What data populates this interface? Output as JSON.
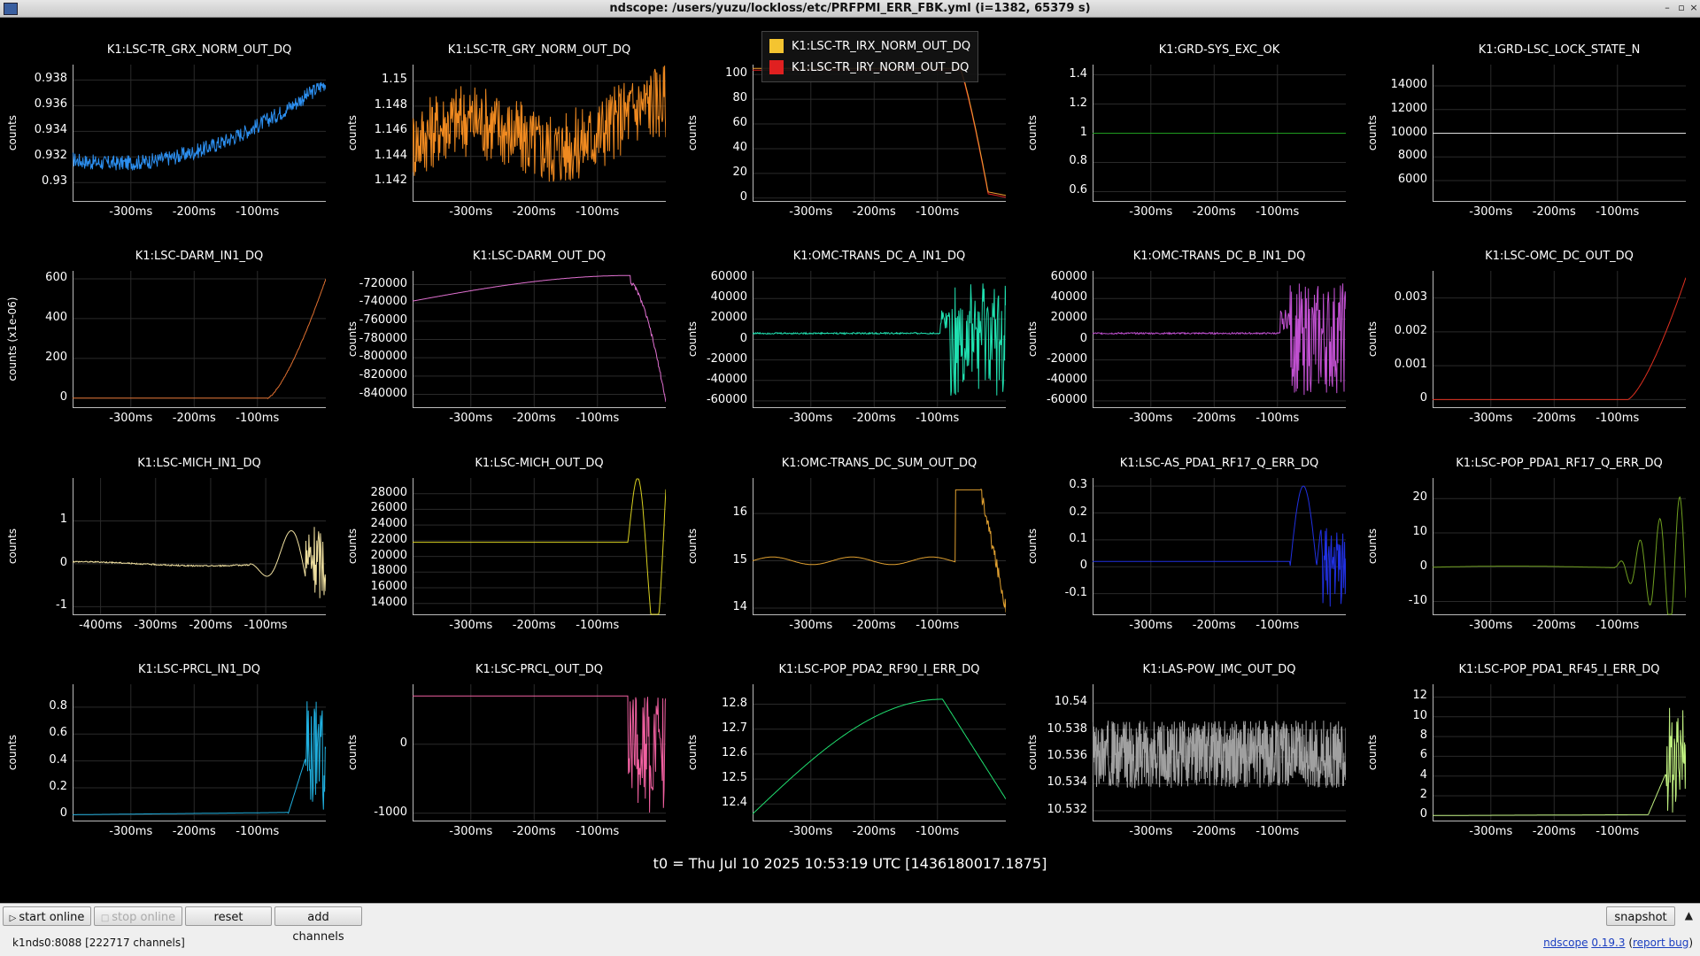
{
  "window": {
    "title": "ndscope: /users/yuzu/lockloss/etc/PRFPMI_ERR_FBK.yml (i=1382, 65379 s)"
  },
  "t0_label": "t0 = Thu Jul 10 2025 10:53:19 UTC [1436180017.1875]",
  "toolbar": {
    "start_online": "start online",
    "stop_online": "stop online",
    "reset": "reset",
    "add_channels": "add channels",
    "snapshot": "snapshot"
  },
  "status": {
    "server": "k1nds0:8088  [222717 channels]",
    "app_link": "ndscope",
    "version": "0.19.3",
    "open_paren": "(",
    "report_bug": "report bug",
    "close_paren": ")"
  },
  "panels": [
    {
      "title": "K1:LSC-TR_GRX_NORM_OUT_DQ",
      "ylabel": "counts",
      "color": "#2c8ff0",
      "yticks": [
        "0.938",
        "0.936",
        "0.934",
        "0.932",
        "0.93"
      ],
      "ytick_values": [
        0.938,
        0.936,
        0.934,
        0.932,
        0.93
      ],
      "ylim": [
        0.9285,
        0.9392
      ],
      "xticks": [
        "-300ms",
        "-200ms",
        "-100ms"
      ]
    },
    {
      "title": "K1:LSC-TR_GRY_NORM_OUT_DQ",
      "ylabel": "counts",
      "color": "#f08a20",
      "yticks": [
        "1.15",
        "1.148",
        "1.146",
        "1.144",
        "1.142"
      ],
      "ytick_values": [
        1.15,
        1.148,
        1.146,
        1.144,
        1.142
      ],
      "ylim": [
        1.1404,
        1.1513
      ],
      "xticks": [
        "-300ms",
        "-200ms",
        "-100ms"
      ]
    },
    {
      "title": "",
      "ylabel": "counts",
      "color": "#f0a030",
      "yticks": [
        "100",
        "80",
        "60",
        "40",
        "20",
        "0"
      ],
      "ytick_values": [
        100,
        80,
        60,
        40,
        20,
        0
      ],
      "ylim": [
        -3,
        108
      ],
      "xticks": [
        "-300ms",
        "-200ms",
        "-100ms"
      ],
      "legend": [
        {
          "name": "K1:LSC-TR_IRX_NORM_OUT_DQ",
          "color": "#f4c430"
        },
        {
          "name": "K1:LSC-TR_IRY_NORM_OUT_DQ",
          "color": "#e02020"
        }
      ]
    },
    {
      "title": "K1:GRD-SYS_EXC_OK",
      "ylabel": "counts",
      "color": "#1f9a1f",
      "yticks": [
        "1.4",
        "1.2",
        "1",
        "0.8",
        "0.6"
      ],
      "ytick_values": [
        1.4,
        1.2,
        1,
        0.8,
        0.6
      ],
      "ylim": [
        0.53,
        1.47
      ],
      "xticks": [
        "-300ms",
        "-200ms",
        "-100ms"
      ]
    },
    {
      "title": "K1:GRD-LSC_LOCK_STATE_N",
      "ylabel": "counts",
      "color": "#e0e0e0",
      "yticks": [
        "14000",
        "12000",
        "10000",
        "8000",
        "6000"
      ],
      "ytick_values": [
        14000,
        12000,
        10000,
        8000,
        6000
      ],
      "ylim": [
        4200,
        15800
      ],
      "xticks": [
        "-300ms",
        "-200ms",
        "-100ms"
      ]
    },
    {
      "title": "K1:LSC-DARM_IN1_DQ",
      "ylabel": "counts (x1e-06)",
      "color": "#e07030",
      "yticks": [
        "600",
        "400",
        "200",
        "0"
      ],
      "ytick_values": [
        600,
        400,
        200,
        0
      ],
      "ylim": [
        -50,
        640
      ],
      "xticks": [
        "-300ms",
        "-200ms",
        "-100ms"
      ]
    },
    {
      "title": "K1:LSC-DARM_OUT_DQ",
      "ylabel": "counts",
      "color": "#e070d0",
      "yticks": [
        "-720000",
        "-740000",
        "-760000",
        "-780000",
        "-800000",
        "-820000",
        "-840000"
      ],
      "ytick_values": [
        -720000,
        -740000,
        -760000,
        -780000,
        -800000,
        -820000,
        -840000
      ],
      "ylim": [
        -855000,
        -705000
      ],
      "xticks": [
        "-300ms",
        "-200ms",
        "-100ms"
      ]
    },
    {
      "title": "K1:OMC-TRANS_DC_A_IN1_DQ",
      "ylabel": "counts",
      "color": "#20e0b0",
      "yticks": [
        "60000",
        "40000",
        "20000",
        "0",
        "-20000",
        "-40000",
        "-60000"
      ],
      "ytick_values": [
        60000,
        40000,
        20000,
        0,
        -20000,
        -40000,
        -60000
      ],
      "ylim": [
        -67000,
        67000
      ],
      "xticks": [
        "-300ms",
        "-200ms",
        "-100ms"
      ]
    },
    {
      "title": "K1:OMC-TRANS_DC_B_IN1_DQ",
      "ylabel": "counts",
      "color": "#c050d0",
      "yticks": [
        "60000",
        "40000",
        "20000",
        "0",
        "-20000",
        "-40000",
        "-60000"
      ],
      "ytick_values": [
        60000,
        40000,
        20000,
        0,
        -20000,
        -40000,
        -60000
      ],
      "ylim": [
        -67000,
        67000
      ],
      "xticks": [
        "-300ms",
        "-200ms",
        "-100ms"
      ]
    },
    {
      "title": "K1:LSC-OMC_DC_OUT_DQ",
      "ylabel": "counts",
      "color": "#e03020",
      "yticks": [
        "0.003",
        "0.002",
        "0.001",
        "0"
      ],
      "ytick_values": [
        0.003,
        0.002,
        0.001,
        0
      ],
      "ylim": [
        -0.00025,
        0.0038
      ],
      "xticks": [
        "-300ms",
        "-200ms",
        "-100ms"
      ]
    },
    {
      "title": "K1:LSC-MICH_IN1_DQ",
      "ylabel": "counts",
      "color": "#f0e0a0",
      "yticks": [
        "1",
        "0",
        "-1"
      ],
      "ytick_values": [
        1,
        0,
        -1
      ],
      "ylim": [
        -1.2,
        2.0
      ],
      "xticks": [
        "-400ms",
        "-300ms",
        "-200ms",
        "-100ms"
      ]
    },
    {
      "title": "K1:LSC-MICH_OUT_DQ",
      "ylabel": "counts",
      "color": "#d8d020",
      "yticks": [
        "28000",
        "26000",
        "24000",
        "22000",
        "20000",
        "18000",
        "16000",
        "14000"
      ],
      "ytick_values": [
        28000,
        26000,
        24000,
        22000,
        20000,
        18000,
        16000,
        14000
      ],
      "ylim": [
        12500,
        30000
      ],
      "xticks": [
        "-300ms",
        "-200ms",
        "-100ms"
      ]
    },
    {
      "title": "K1:OMC-TRANS_DC_SUM_OUT_DQ",
      "ylabel": "counts",
      "color": "#e0a030",
      "yticks": [
        "16",
        "15",
        "14"
      ],
      "ytick_values": [
        16,
        15,
        14
      ],
      "ylim": [
        13.85,
        16.75
      ],
      "xticks": [
        "-300ms",
        "-200ms",
        "-100ms"
      ]
    },
    {
      "title": "K1:LSC-AS_PDA1_RF17_Q_ERR_DQ",
      "ylabel": "counts",
      "color": "#2030e0",
      "yticks": [
        "0.3",
        "0.2",
        "0.1",
        "0",
        "-0.1"
      ],
      "ytick_values": [
        0.3,
        0.2,
        0.1,
        0,
        -0.1
      ],
      "ylim": [
        -0.18,
        0.33
      ],
      "xticks": [
        "-300ms",
        "-200ms",
        "-100ms"
      ]
    },
    {
      "title": "K1:LSC-POP_PDA1_RF17_Q_ERR_DQ",
      "ylabel": "counts",
      "color": "#70a020",
      "yticks": [
        "20",
        "10",
        "0",
        "-10"
      ],
      "ytick_values": [
        20,
        10,
        0,
        -10
      ],
      "ylim": [
        -14,
        26
      ],
      "xticks": [
        "-300ms",
        "-200ms",
        "-100ms"
      ]
    },
    {
      "title": "K1:LSC-PRCL_IN1_DQ",
      "ylabel": "counts",
      "color": "#20b0e0",
      "yticks": [
        "0.8",
        "0.6",
        "0.4",
        "0.2",
        "0"
      ],
      "ytick_values": [
        0.8,
        0.6,
        0.4,
        0.2,
        0
      ],
      "ylim": [
        -0.05,
        0.97
      ],
      "xticks": [
        "-300ms",
        "-200ms",
        "-100ms"
      ]
    },
    {
      "title": "K1:LSC-PRCL_OUT_DQ",
      "ylabel": "counts",
      "color": "#f060a0",
      "yticks": [
        "0",
        "-1000"
      ],
      "ytick_values": [
        0,
        -1000
      ],
      "ylim": [
        -1120,
        870
      ],
      "xticks": [
        "-300ms",
        "-200ms",
        "-100ms"
      ]
    },
    {
      "title": "K1:LSC-POP_PDA2_RF90_I_ERR_DQ",
      "ylabel": "counts",
      "color": "#20e070",
      "yticks": [
        "12.8",
        "12.7",
        "12.6",
        "12.5",
        "12.4"
      ],
      "ytick_values": [
        12.8,
        12.7,
        12.6,
        12.5,
        12.4
      ],
      "ylim": [
        12.33,
        12.88
      ],
      "xticks": [
        "-300ms",
        "-200ms",
        "-100ms"
      ]
    },
    {
      "title": "K1:LAS-POW_IMC_OUT_DQ",
      "ylabel": "counts",
      "color": "#a0a0a0",
      "yticks": [
        "10.54",
        "10.538",
        "10.536",
        "10.534",
        "10.532"
      ],
      "ytick_values": [
        10.54,
        10.538,
        10.536,
        10.534,
        10.532
      ],
      "ylim": [
        10.5312,
        10.5414
      ],
      "xticks": [
        "-300ms",
        "-200ms",
        "-100ms"
      ]
    },
    {
      "title": "K1:LSC-POP_PDA1_RF45_I_ERR_DQ",
      "ylabel": "counts",
      "color": "#c0f080",
      "yticks": [
        "12",
        "10",
        "8",
        "6",
        "4",
        "2",
        "0"
      ],
      "ytick_values": [
        12,
        10,
        8,
        6,
        4,
        2,
        0
      ],
      "ylim": [
        -0.6,
        13.3
      ],
      "xticks": [
        "-300ms",
        "-200ms",
        "-100ms"
      ]
    }
  ]
}
